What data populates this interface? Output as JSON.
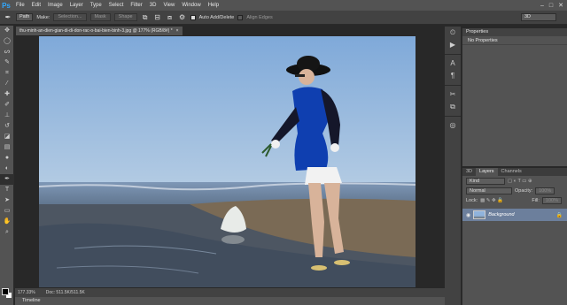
{
  "app": {
    "logo": "Ps"
  },
  "menu": [
    "File",
    "Edit",
    "Image",
    "Layer",
    "Type",
    "Select",
    "Filter",
    "3D",
    "View",
    "Window",
    "Help"
  ],
  "window_controls": [
    "–",
    "□",
    "✕"
  ],
  "options": {
    "mode_select": "Path",
    "make_label": "Make:",
    "selection_btn": "Selection...",
    "mask_btn": "Mask",
    "shape_btn": "Shape",
    "auto_add_delete": "Auto Add/Delete",
    "align_edges": "Align Edges",
    "workspace": "3D"
  },
  "document": {
    "tab_title": "thu-minh-an-dien-gian-di-di-don-rac-o-bai-bien-binh-3.jpg @ 177% (RGB/8#) *",
    "tab_close": "×",
    "zoom": "177.33%",
    "doc_info": "Doc: 511.5K/511.5K"
  },
  "timeline_label": "Timeline",
  "properties": {
    "tab": "Properties",
    "subtitle": "No Properties"
  },
  "layers": {
    "tabs": [
      "3D",
      "Layers",
      "Channels"
    ],
    "kind_filter": "Kind",
    "blend_mode": "Normal",
    "opacity_label": "Opacity:",
    "opacity_value": "100%",
    "lock_label": "Lock:",
    "fill_label": "Fill:",
    "fill_value": "100%",
    "layer_name": "Background"
  },
  "colors": {
    "accent": "#31a8ff",
    "panel": "#535353",
    "layer_selected": "#6c7f9c"
  }
}
